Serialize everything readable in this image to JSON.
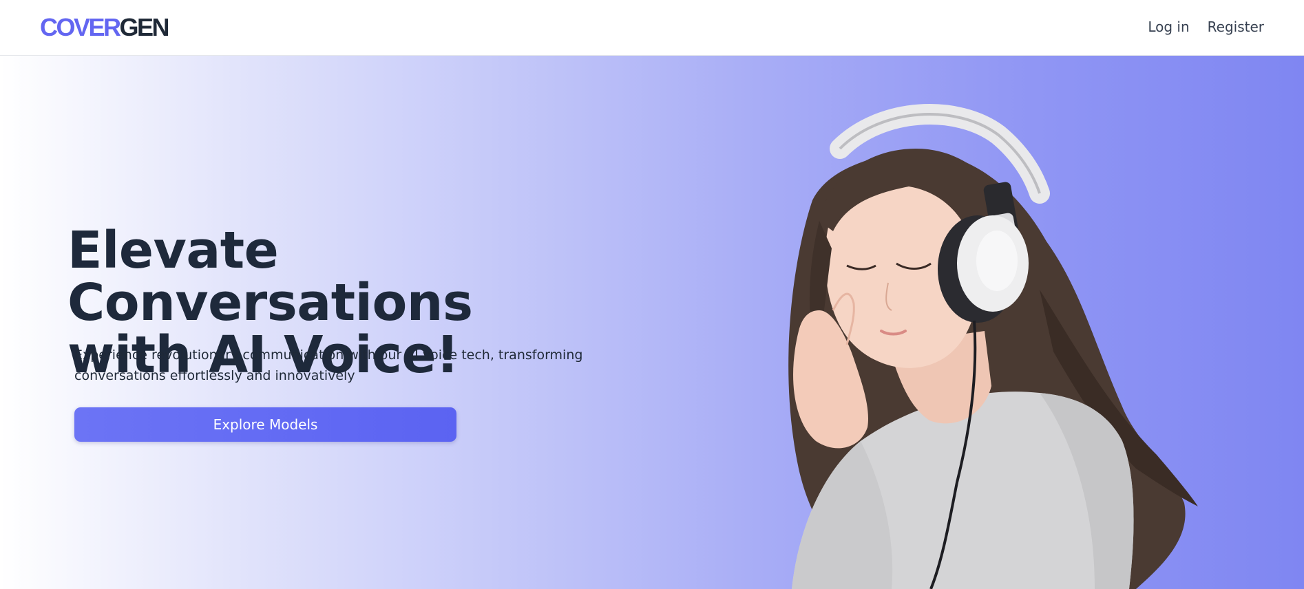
{
  "brand": {
    "logo_part1": "COVER",
    "logo_part2": "GEN",
    "colors": {
      "accent": "#6366f1",
      "dark": "#1f2937"
    }
  },
  "nav": {
    "login_label": "Log in",
    "register_label": "Register"
  },
  "hero": {
    "headline_line1": "Elevate Conversations",
    "headline_line2": "with AI Voice!",
    "subtext_line1": "Experience revolutionary communication with our AI voice tech, transforming",
    "subtext_line2": "conversations effortlessly and innovatively",
    "cta_label": "Explore Models",
    "image_subject": "girl-with-headphones-illustration",
    "gradient_colors": [
      "#ffffff",
      "#c5c9f9",
      "#7f86f2"
    ]
  }
}
